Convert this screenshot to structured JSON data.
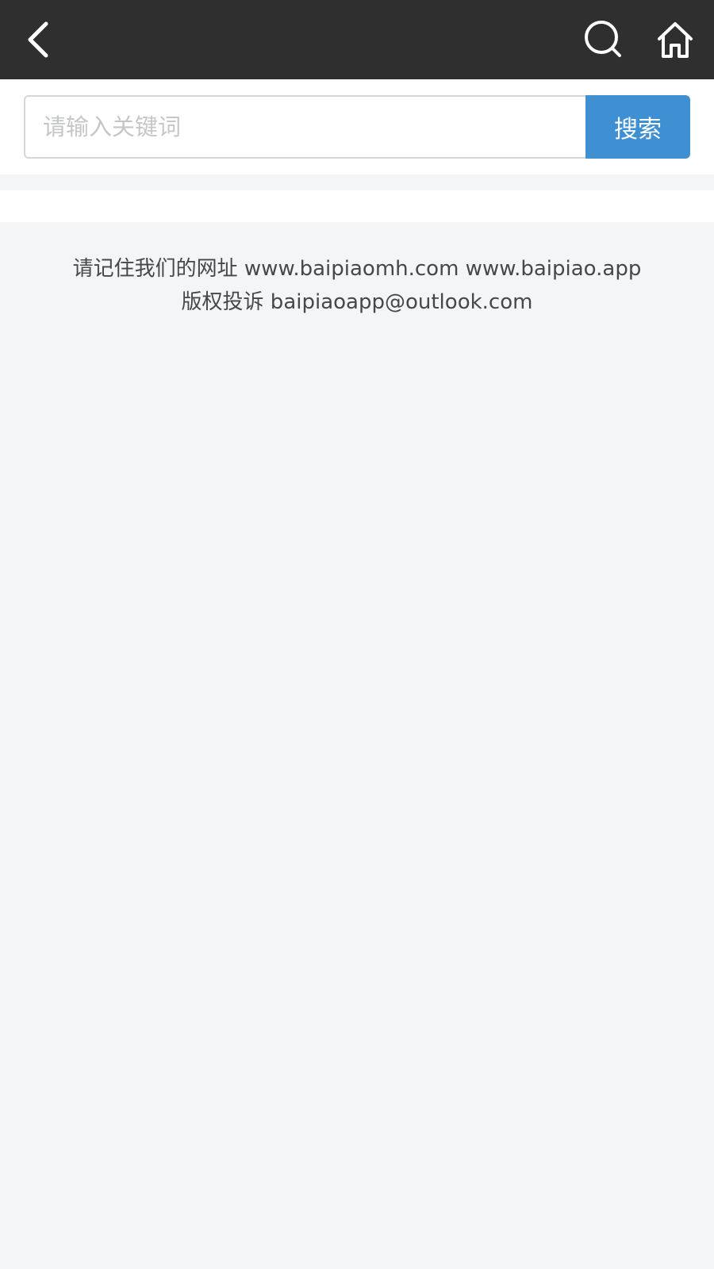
{
  "header": {
    "icons": {
      "back": "chevron-left-icon",
      "search": "search-icon",
      "home": "home-icon"
    },
    "background_color": "#2f2f2f"
  },
  "search": {
    "placeholder": "请输入关键词",
    "value": "",
    "button_label": "搜索",
    "button_color": "#3f8fd3"
  },
  "footer": {
    "line1": "请记住我们的网址 www.baipiaomh.com www.baipiao.app",
    "line2": "版权投诉 baipiaoapp@outlook.com"
  }
}
